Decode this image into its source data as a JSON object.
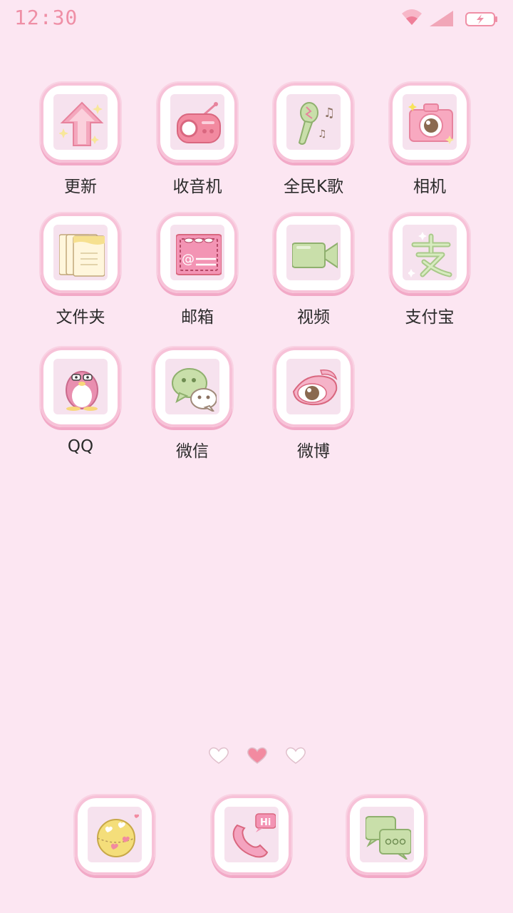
{
  "status_bar": {
    "time": "12:30"
  },
  "home": {
    "apps": [
      {
        "label": "更新",
        "icon": "update-arrow-icon"
      },
      {
        "label": "收音机",
        "icon": "radio-icon"
      },
      {
        "label": "全民K歌",
        "icon": "microphone-icon"
      },
      {
        "label": "相机",
        "icon": "camera-icon"
      },
      {
        "label": "文件夹",
        "icon": "folder-icon"
      },
      {
        "label": "邮箱",
        "icon": "mail-icon"
      },
      {
        "label": "视频",
        "icon": "video-camera-icon"
      },
      {
        "label": "支付宝",
        "icon": "alipay-icon"
      },
      {
        "label": "QQ",
        "icon": "penguin-icon"
      },
      {
        "label": "微信",
        "icon": "chat-bubbles-icon"
      },
      {
        "label": "微博",
        "icon": "weibo-eye-icon"
      }
    ]
  },
  "page_indicator": {
    "count": 3,
    "current": 2
  },
  "dock": [
    {
      "icon": "globe-browser-icon"
    },
    {
      "icon": "phone-icon",
      "badge": "Hi"
    },
    {
      "icon": "messages-icon"
    }
  ],
  "colors": {
    "background": "#fce6f2",
    "accent_pink": "#ef8fa6",
    "soft_green": "#c9dfaa",
    "tile_border": "#f7c2d8"
  }
}
